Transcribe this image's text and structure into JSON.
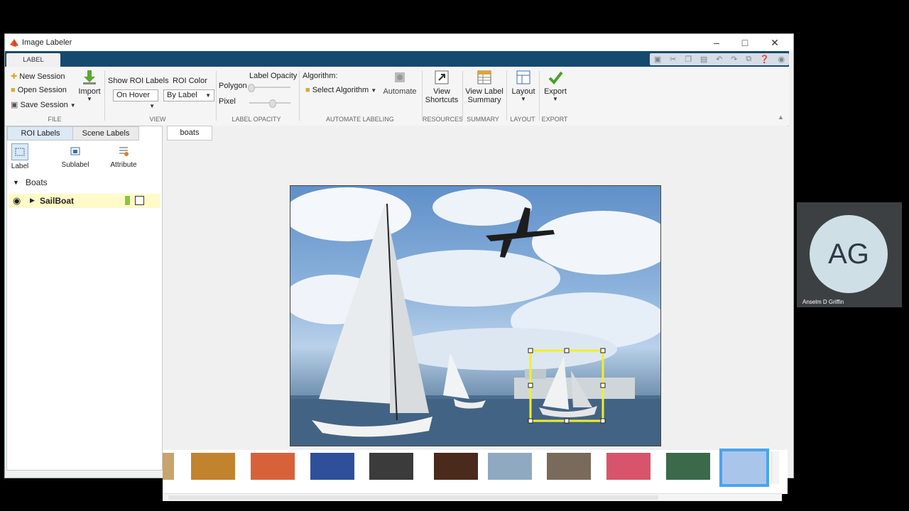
{
  "window": {
    "title": "Image Labeler",
    "tab_label": "LABEL"
  },
  "ribbon": {
    "file": {
      "new_session": "New Session",
      "open_session": "Open Session",
      "save_session": "Save Session",
      "import": "Import",
      "section": "FILE"
    },
    "view": {
      "show_roi_labels": "Show ROI Labels",
      "roi_color": "ROI Color",
      "show_roi_value": "On Hover",
      "roi_color_value": "By Label",
      "section": "VIEW"
    },
    "opacity": {
      "label_opacity": "Label Opacity",
      "polygon": "Polygon",
      "pixel": "Pixel",
      "polygon_level": 0.0,
      "pixel_level": 0.4,
      "section": "LABEL OPACITY"
    },
    "automate": {
      "algorithm": "Algorithm:",
      "select_algorithm": "Select Algorithm",
      "automate": "Automate",
      "section": "AUTOMATE LABELING"
    },
    "resources": {
      "view": "View",
      "shortcuts": "Shortcuts",
      "section": "RESOURCES"
    },
    "summary": {
      "view_label": "View Label",
      "summary": "Summary",
      "section": "SUMMARY"
    },
    "layout": {
      "label": "Layout",
      "section": "LAYOUT"
    },
    "export": {
      "label": "Export",
      "section": "EXPORT"
    }
  },
  "left_panel": {
    "tabs": [
      "ROI Labels",
      "Scene Labels"
    ],
    "tools": [
      "Label",
      "Sublabel",
      "Attribute"
    ],
    "group": "Boats",
    "label": "SailBoat",
    "label_color": "#8cc63f"
  },
  "document": {
    "tab": "boats"
  },
  "thumbnails": {
    "colors": [
      "#c8a36b",
      "#c2832f",
      "#d7623a",
      "#2f4f9a",
      "#3b3b3b",
      "#4a2a1a",
      "#8fa9c0",
      "#7a6a5a",
      "#d8546a",
      "#3a6a4a",
      "#a9c6ea"
    ],
    "selected_index": 10
  },
  "video_tile": {
    "initials": "AG",
    "name": "Anselm D Griffin"
  }
}
